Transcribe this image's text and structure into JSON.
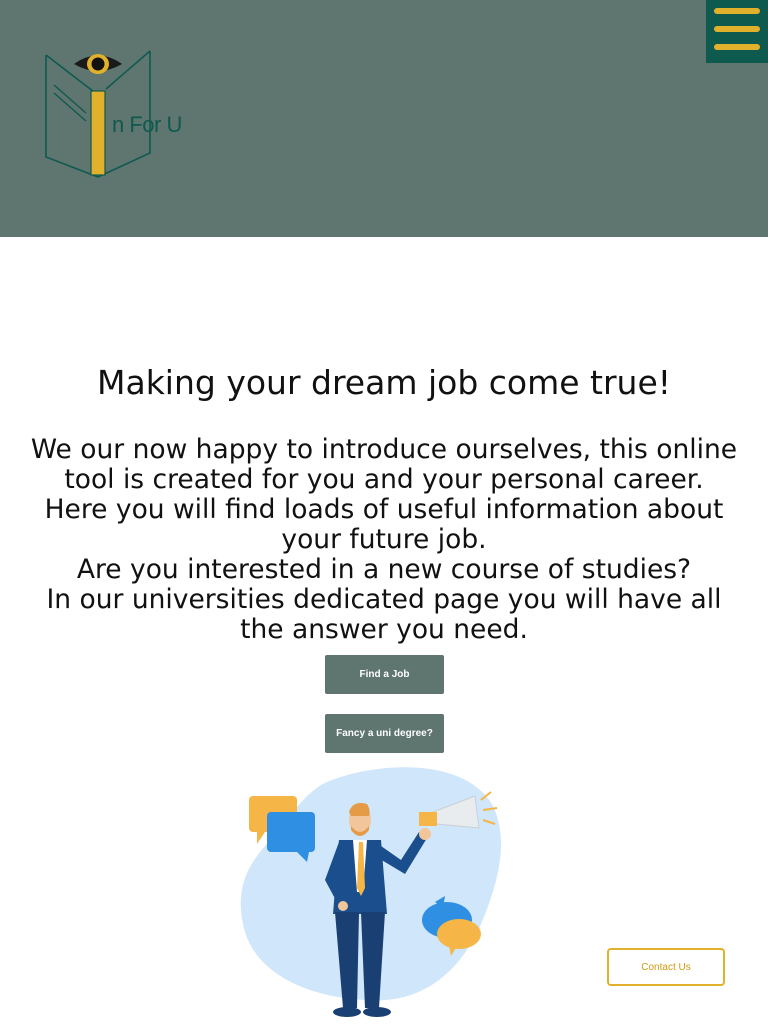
{
  "header": {
    "logo_text": "n For U",
    "logo_icon": "eye-book-logo",
    "menu_icon": "hamburger-menu-icon"
  },
  "main": {
    "headline": "Making your dream job come true!",
    "intro_lines": [
      "We our now happy to introduce ourselves, this online tool is created for you and your personal career.",
      "Here you will find loads of useful information about your future job.",
      "Are you interested in a new course of studies?",
      "In our universities dedicated page you will have all the answer you need."
    ],
    "find_job_label": "Find a Job",
    "uni_degree_label": "Fancy a uni degree?",
    "illustration_icon": "businessman-megaphone-illustration"
  },
  "contact": {
    "label": "Contact Us"
  },
  "colors": {
    "header_bg": "#5e7570",
    "menu_bg": "#0f5a4f",
    "accent_yellow": "#e1b12c",
    "button_bg": "#5e7570"
  }
}
